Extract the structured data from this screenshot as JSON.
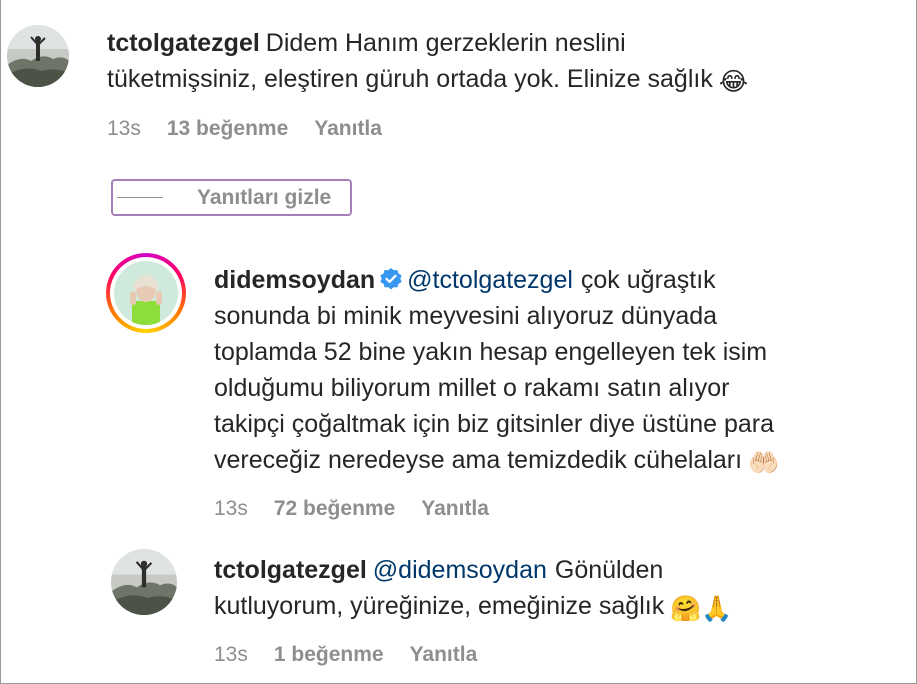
{
  "comments": [
    {
      "username": "tctolgatezgel",
      "line1": "Didem Hanım gerzeklerin neslini",
      "line2": "tüketmişsiniz, eleştiren güruh ortada yok. Elinize sağlık",
      "emoji": "😂",
      "time": "13s",
      "likes": "13 beğenme",
      "reply": "Yanıtla"
    }
  ],
  "replies_toggle": {
    "label": "Yanıtları gizle"
  },
  "replies": [
    {
      "username": "didemsoydan",
      "verified": true,
      "mention": "@tctolgatezgel",
      "lines": [
        "çok uğraştık",
        "sonunda bi minik meyvesini alıyoruz dünyada",
        "toplamda 52 bine yakın hesap engelleyen tek isim",
        "olduğumu biliyorum millet o rakamı satın alıyor",
        "takipçi çoğaltmak için biz gitsinler diye üstüne para",
        "vereceğiz neredeyse ama temizdedik cühelaları"
      ],
      "emoji": "🤲🏻",
      "time": "13s",
      "likes": "72 beğenme",
      "reply": "Yanıtla"
    },
    {
      "username": "tctolgatezgel",
      "mention": "@didemsoydan",
      "line1": "Gönülden",
      "line2": "kutluyorum, yüreğinize, emeğinize sağlık",
      "emoji": "🤗🙏",
      "time": "13s",
      "likes": "1 beğenme",
      "reply": "Yanıtla"
    }
  ],
  "colors": {
    "text": "#262626",
    "meta": "#8e8e8e",
    "mention": "#00376b",
    "verified": "#3897f0",
    "toggle_border": "#a77fb8"
  }
}
